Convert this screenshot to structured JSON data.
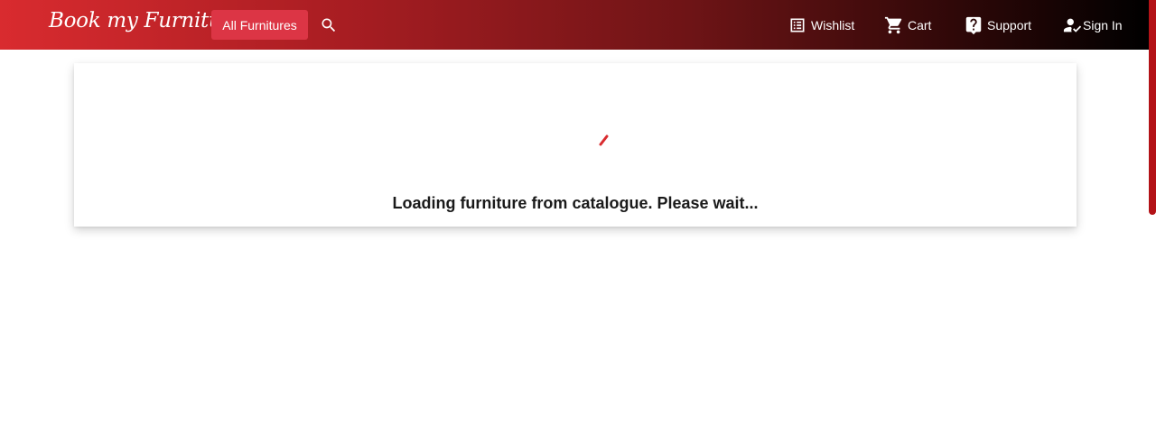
{
  "navbar": {
    "brand": "Book my Furniture",
    "all_furnitures_label": "All Furnitures",
    "search_icon": "search-icon",
    "items": [
      {
        "label": "Wishlist",
        "icon": "list-icon"
      },
      {
        "label": "Cart",
        "icon": "cart-icon"
      },
      {
        "label": "Support",
        "icon": "help-icon"
      },
      {
        "label": "Sign In",
        "icon": "person-check-icon"
      }
    ],
    "colors": {
      "gradient_start": "#d92b2f",
      "gradient_end": "#000000",
      "button_bg": "#dc3545"
    }
  },
  "main": {
    "loading_message": "Loading furniture from catalogue. Please wait...",
    "spinner_color": "#d92b2f"
  },
  "scrollbar": {
    "thumb_color": "#b31217"
  }
}
